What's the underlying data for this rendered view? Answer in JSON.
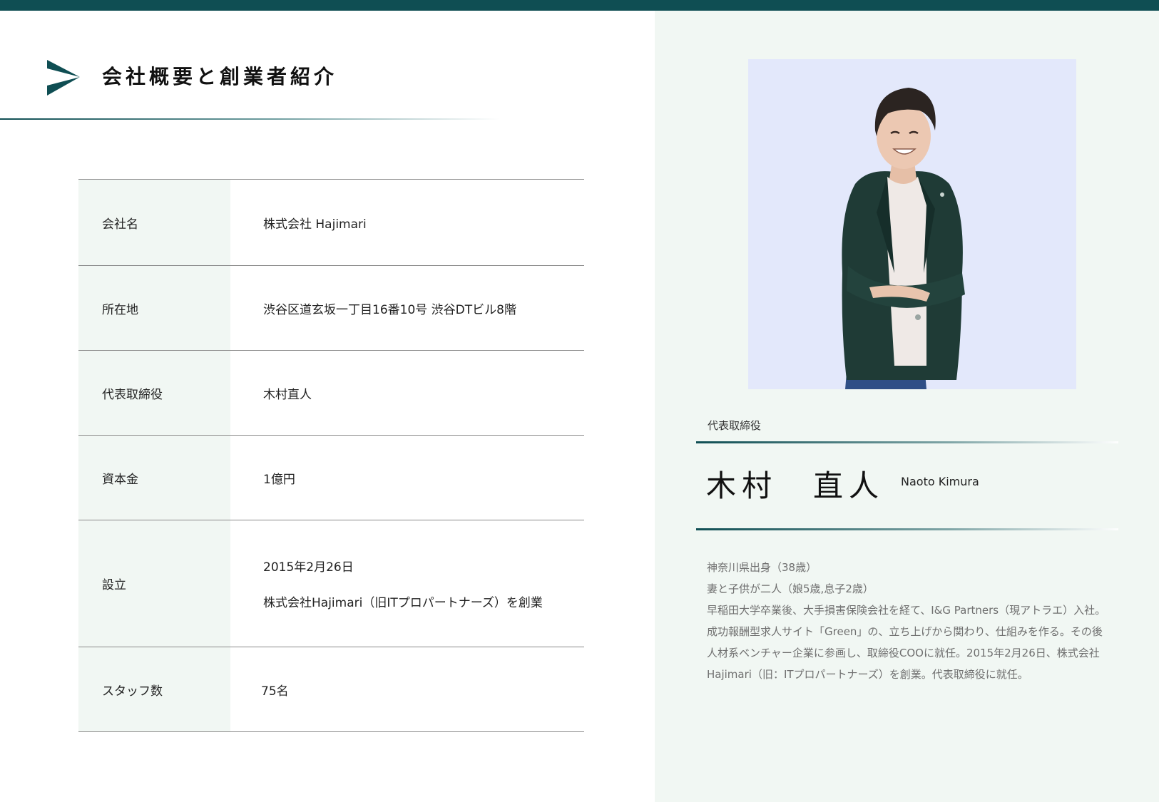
{
  "header": {
    "title": "会社概要と創業者紹介"
  },
  "company_table": [
    {
      "label": "会社名",
      "values": [
        "株式会社 Hajimari"
      ]
    },
    {
      "label": "所在地",
      "values": [
        "渋谷区道玄坂一丁目16番10号 渋谷DTビル8階"
      ]
    },
    {
      "label": "代表取締役",
      "values": [
        "木村直人"
      ]
    },
    {
      "label": "資本金",
      "values": [
        "1億円"
      ]
    },
    {
      "label": "設立",
      "values": [
        "2015年2月26日",
        "株式会社Hajimari（旧ITプロパートナーズ）を創業"
      ]
    },
    {
      "label": "スタッフ数",
      "values": [
        "75名"
      ]
    }
  ],
  "founder": {
    "role": "代表取締役",
    "name_jp": "木村　直人",
    "name_en": "Naoto Kimura",
    "bio": [
      "神奈川県出身（38歳）",
      "妻と子供が二人（娘5歳,息子2歳）",
      "早稲田大学卒業後、大手損害保険会社を経て、I&G Partners（現アトラエ）入社。成功報酬型求人サイト「Green」の、立ち上げから関わり、仕組みを作る。その後人材系ベンチャー企業に参画し、取締役COOに就任。2015年2月26日、株式会社Hajimari（旧：ITプロパートナーズ）を創業。代表取締役に就任。"
    ]
  },
  "colors": {
    "brand": "#0f4e53",
    "panel_bg": "#f1f7f3",
    "photo_bg": "#e3e8fb"
  }
}
